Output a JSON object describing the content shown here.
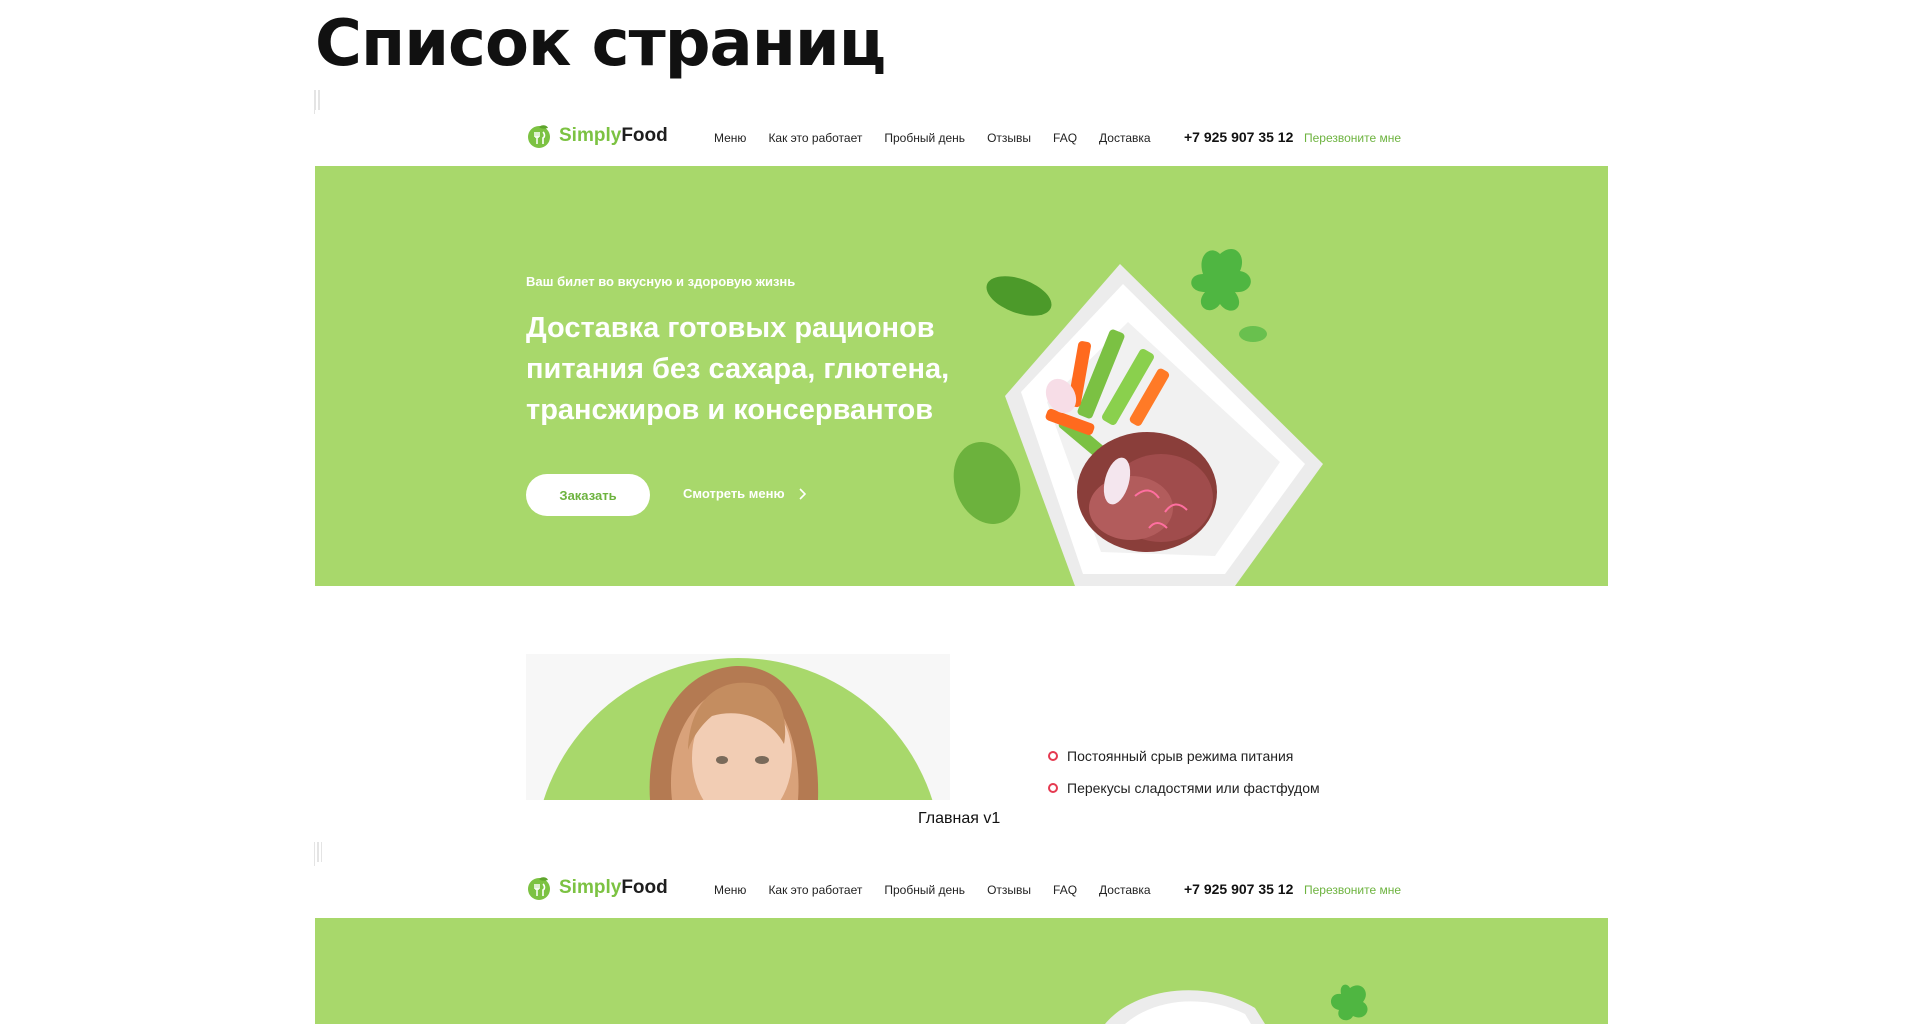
{
  "page": {
    "title": "Список страниц"
  },
  "site": {
    "logo": {
      "part1": "Simply",
      "part2": "Food"
    },
    "nav": [
      "Меню",
      "Как это работает",
      "Пробный день",
      "Отзывы",
      "FAQ",
      "Доставка"
    ],
    "phone": "+7 925 907 35 12",
    "callback": "Перезвоните мне"
  },
  "hero": {
    "tagline": "Ваш билет во вкусную и здоровую жизнь",
    "title": "Доставка готовых рационов питания без сахара, глютена, трансжиров и консервантов",
    "order_button": "Заказать",
    "menu_link": "Смотреть меню"
  },
  "problems": {
    "items": [
      "Постоянный срыв режима питания",
      "Перекусы сладостями или фастфудом"
    ]
  },
  "previews": [
    {
      "caption": "Главная v1"
    }
  ],
  "colors": {
    "accent": "#a8d86b",
    "brand": "#7cc242",
    "bullet": "#e53950"
  }
}
